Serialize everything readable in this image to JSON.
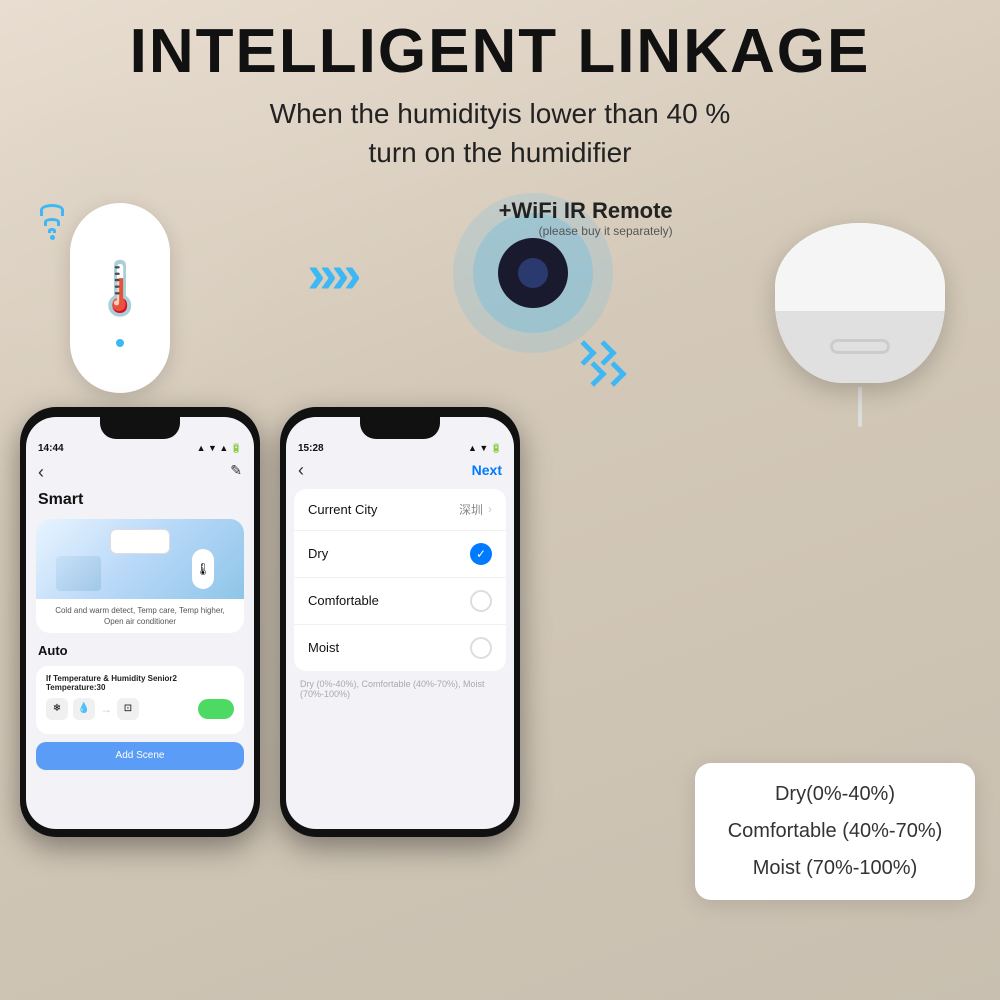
{
  "header": {
    "title": "INTELLIGENT LINKAGE",
    "subtitle_line1": "When the humidityis lower than 40 %",
    "subtitle_line2": "turn on the humidifier"
  },
  "ir_remote": {
    "label": "+WiFi IR Remote",
    "sublabel": "(please buy it separately)"
  },
  "phone1": {
    "status_bar": {
      "time": "14:44",
      "signal": "▲ ● ▲"
    },
    "section": "Smart",
    "card_desc": "Cold and warm detect, Temp care, Temp higher, Open air conditioner",
    "auto_label": "Auto",
    "rule_title": "If Temperature & Humidity Senior2\nTemperature:30",
    "add_scene": "Add Scene"
  },
  "phone2": {
    "status_bar": {
      "time": "15:28",
      "signal": "▲ ● ▲"
    },
    "nav_next": "Next",
    "current_city_label": "Current City",
    "current_city_value": "深圳",
    "dry_label": "Dry",
    "comfortable_label": "Comfortable",
    "moist_label": "Moist",
    "hint": "Dry (0%-40%), Comfortable (40%-70%), Moist (70%-100%)"
  },
  "info_box": {
    "items": [
      "Dry(0%-40%)",
      "Comfortable (40%-70%)",
      "Moist (70%-100%)"
    ]
  }
}
